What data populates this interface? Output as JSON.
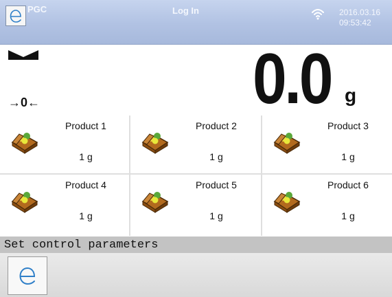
{
  "header": {
    "app_title": "PGC",
    "login_label": "Log In",
    "date": "2016.03.16",
    "time": "09:53:42",
    "logo_icon": "e-logo-icon",
    "wifi_icon": "wifi-icon"
  },
  "weight": {
    "value": "0.0",
    "unit": "g",
    "zero_indicator": "→0←",
    "stability_icon": "stable-indicator-icon"
  },
  "products": [
    {
      "name": "Product 1",
      "mass": "1 g",
      "icon": "product-box-icon"
    },
    {
      "name": "Product 2",
      "mass": "1 g",
      "icon": "product-box-icon"
    },
    {
      "name": "Product 3",
      "mass": "1 g",
      "icon": "product-box-icon"
    },
    {
      "name": "Product 4",
      "mass": "1 g",
      "icon": "product-box-icon"
    },
    {
      "name": "Product 5",
      "mass": "1 g",
      "icon": "product-box-icon"
    },
    {
      "name": "Product 6",
      "mass": "1 g",
      "icon": "product-box-icon"
    }
  ],
  "status": {
    "message": "Set control parameters"
  },
  "bottom_bar": {
    "button_icon": "e-logo-icon"
  },
  "colors": {
    "header_bg": "#b1c2e3",
    "status_bg": "#c3c3c3",
    "logo_blue": "#2f7fc8"
  }
}
